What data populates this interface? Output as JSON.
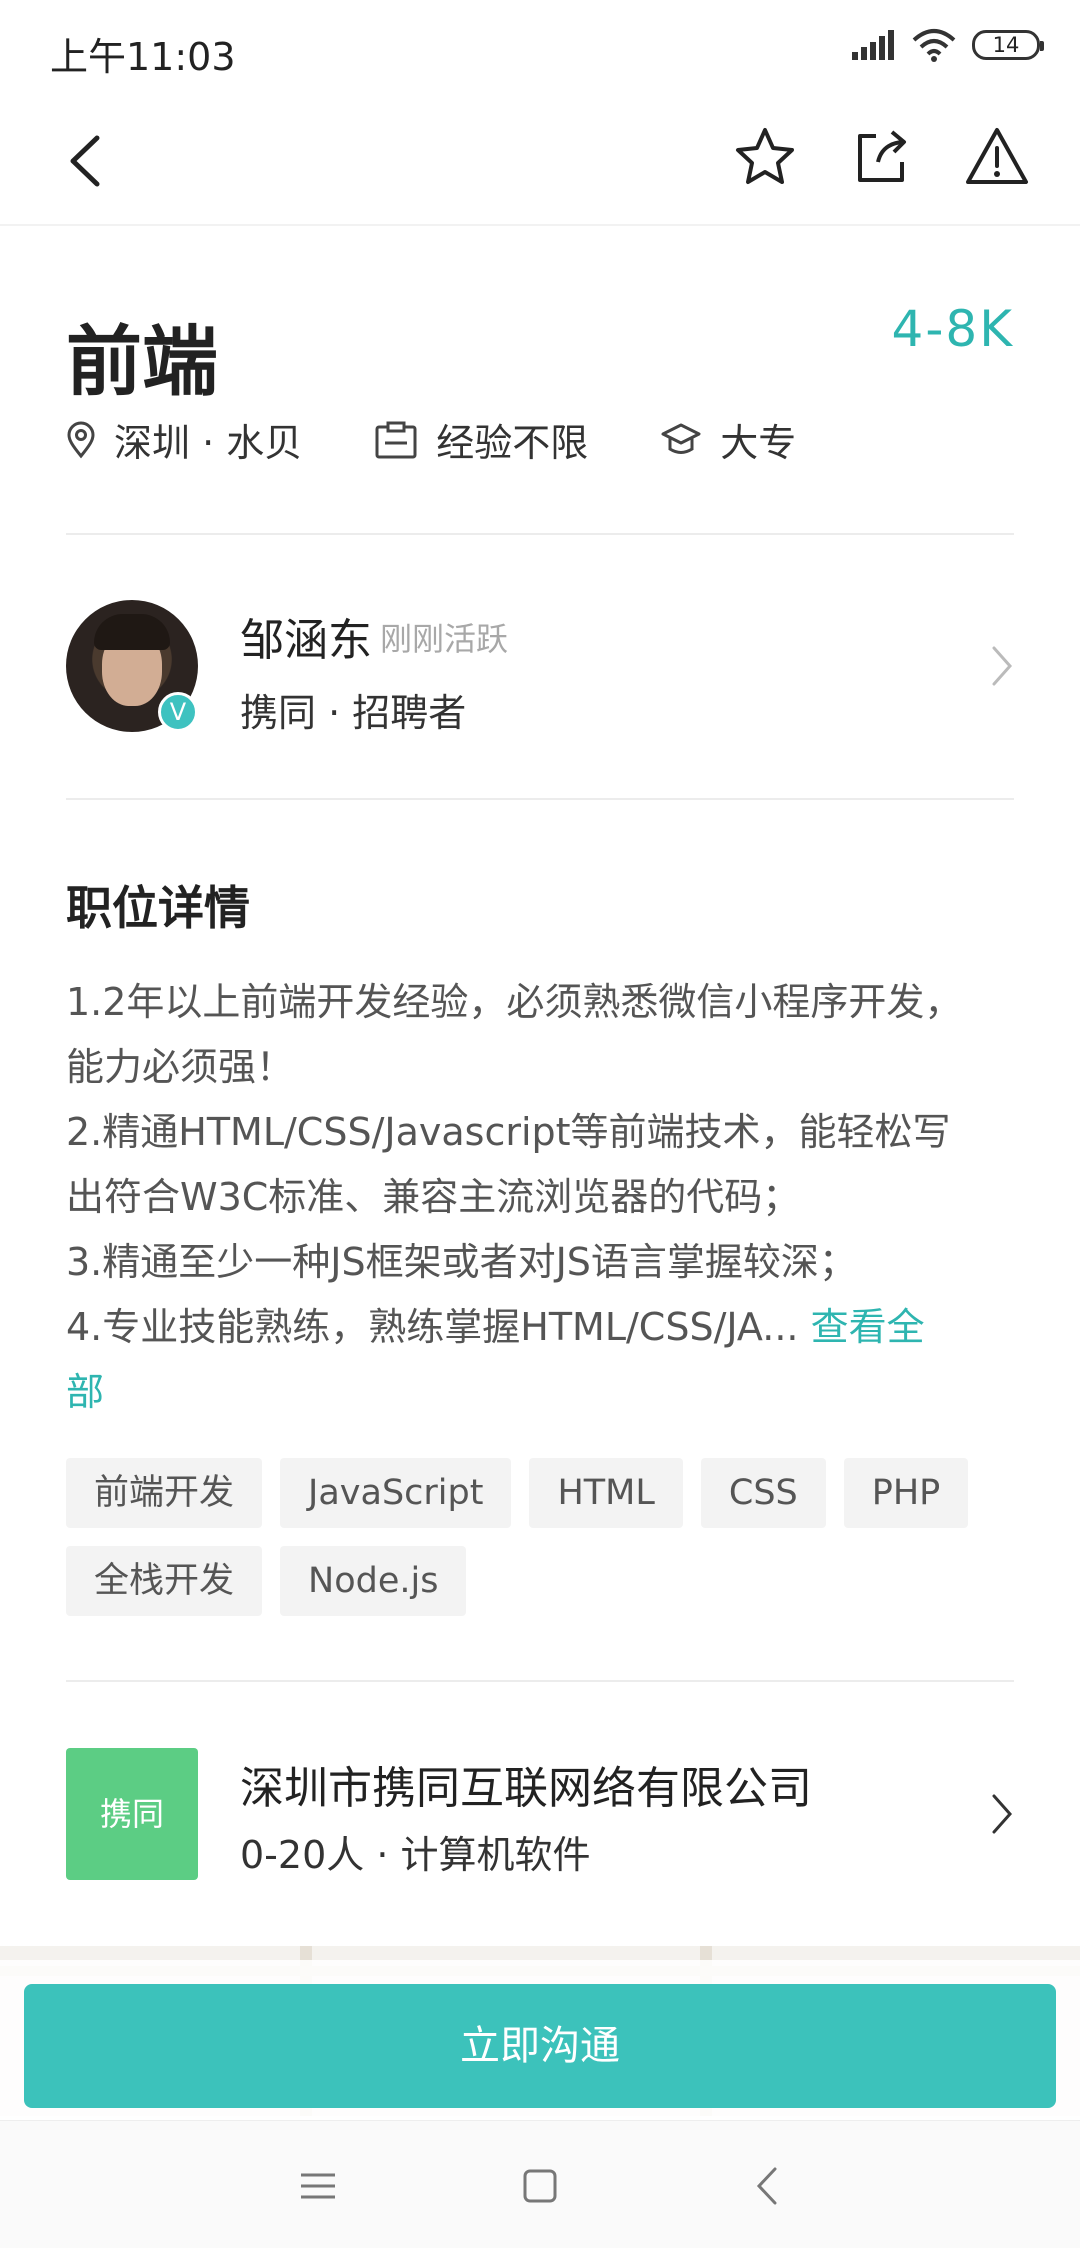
{
  "status_bar": {
    "time": "上午11:03",
    "battery": "14"
  },
  "job": {
    "title": "前端",
    "salary": "4-8K",
    "location": "深圳 · 水贝",
    "experience": "经验不限",
    "education": "大专"
  },
  "recruiter": {
    "name": "邹涵东",
    "active": "刚刚活跃",
    "role": "携同 · 招聘者",
    "badge": "V"
  },
  "details": {
    "title": "职位详情",
    "lines": [
      "1.2年以上前端开发经验，必须熟悉微信小程序开发，",
      "能力必须强！",
      "2.精通HTML/CSS/Javascript等前端技术，能轻松写",
      "出符合W3C标准、兼容主流浏览器的代码；",
      "3.精通至少一种JS框架或者对JS语言掌握较深；",
      "4.专业技能熟练，熟练掌握HTML/CSS/JA..."
    ],
    "more_part1": "查看全",
    "more_part2": "部"
  },
  "tags": {
    "row1": [
      "前端开发",
      "JavaScript",
      "HTML",
      "CSS",
      "PHP"
    ],
    "row2": [
      "全栈开发",
      "Node.js"
    ]
  },
  "company": {
    "logo_text": "携同",
    "name": "深圳市携同互联网络有限公司",
    "info": "0-20人 · 计算机软件"
  },
  "cta": {
    "label": "立即沟通"
  },
  "icons": {
    "back": "back-arrow-icon",
    "favorite": "star-icon",
    "share": "share-icon",
    "report": "warning-icon"
  },
  "colors": {
    "accent": "#2eb5b0",
    "cta": "#3cc2bb",
    "company_logo": "#5ccd84"
  }
}
